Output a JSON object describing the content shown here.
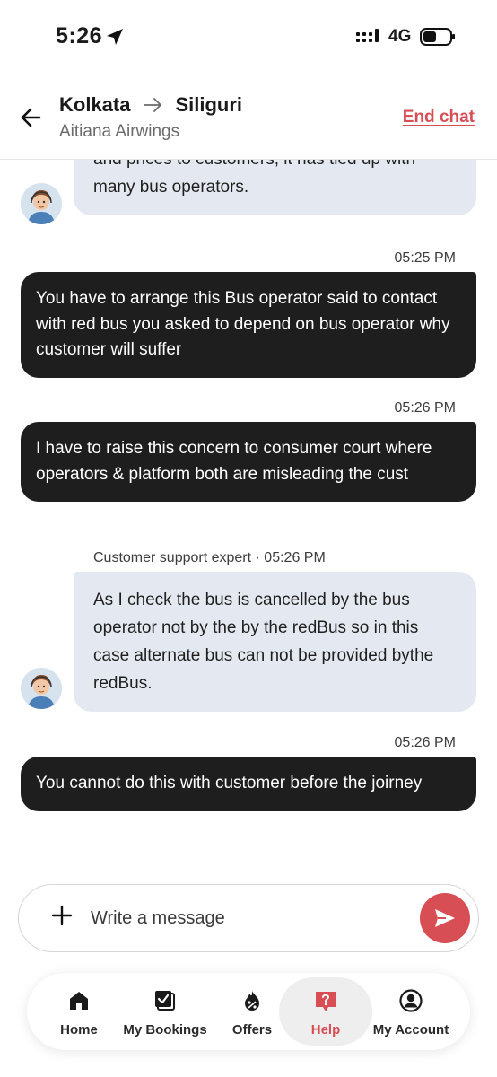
{
  "status_bar": {
    "time": "5:26",
    "network": "4G"
  },
  "header": {
    "from_city": "Kolkata",
    "to_city": "Siliguri",
    "operator": "Aitiana Airwings",
    "end_chat_label": "End chat"
  },
  "messages": [
    {
      "sender": "agent",
      "text": "and prices to customers, it has tied up with many bus operators."
    },
    {
      "sender": "user",
      "timestamp": "05:25 PM",
      "text": "You have to arrange this Bus operator said to contact with red bus you asked to depend on bus operator why customer will suffer"
    },
    {
      "sender": "user",
      "timestamp": "05:26 PM",
      "text": "I have to raise this concern to consumer court where operators & platform both are misleading the cust"
    },
    {
      "sender": "agent",
      "meta": "Customer support expert · 05:26 PM",
      "text": "As I check the bus is cancelled by the bus operator not by the by the redBus so in this case alternate bus can not be provided bythe redBus."
    },
    {
      "sender": "user",
      "timestamp": "05:26 PM",
      "text": "You cannot do this with customer before the joirney"
    }
  ],
  "composer": {
    "placeholder": "Write a message"
  },
  "bottom_nav": {
    "items": [
      {
        "label": "Home",
        "icon": "home-icon"
      },
      {
        "label": "My Bookings",
        "icon": "bookings-icon"
      },
      {
        "label": "Offers",
        "icon": "offers-icon"
      },
      {
        "label": "Help",
        "icon": "help-icon",
        "active": true
      },
      {
        "label": "My Account",
        "icon": "account-icon"
      }
    ]
  },
  "colors": {
    "accent": "#d84e55",
    "user_bubble": "#1e1e1e",
    "agent_bubble": "#e4e9f1"
  }
}
